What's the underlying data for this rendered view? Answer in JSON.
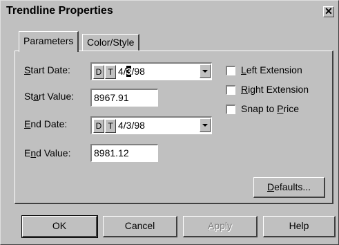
{
  "window": {
    "title": "Trendline Properties",
    "close_glyph": "✕"
  },
  "tabs": [
    {
      "label": "Parameters",
      "active": true
    },
    {
      "label": "Color/Style",
      "active": false
    }
  ],
  "fields": {
    "start_date": {
      "label_pre": "",
      "label_u": "S",
      "label_post": "tart Date:",
      "d": "D",
      "t": "T",
      "before": "4/",
      "caret": "3",
      "after": "/98"
    },
    "start_value": {
      "label_pre": "St",
      "label_u": "a",
      "label_post": "rt Value:",
      "value": "8967.91"
    },
    "end_date": {
      "label_pre": "",
      "label_u": "E",
      "label_post": "nd Date:",
      "d": "D",
      "t": "T",
      "value": "4/3/98"
    },
    "end_value": {
      "label_pre": "E",
      "label_u": "n",
      "label_post": "d Value:",
      "value": "8981.12"
    }
  },
  "checkboxes": [
    {
      "pre": "",
      "u": "L",
      "post": "eft Extension",
      "checked": false
    },
    {
      "pre": "",
      "u": "R",
      "post": "ight Extension",
      "checked": false
    },
    {
      "pre": "Snap to ",
      "u": "P",
      "post": "rice",
      "checked": false
    }
  ],
  "defaults_button": {
    "pre": "",
    "u": "D",
    "post": "efaults..."
  },
  "buttons": {
    "ok": "OK",
    "cancel": "Cancel",
    "apply": {
      "pre": "",
      "u": "A",
      "post": "pply"
    },
    "help": "Help"
  }
}
